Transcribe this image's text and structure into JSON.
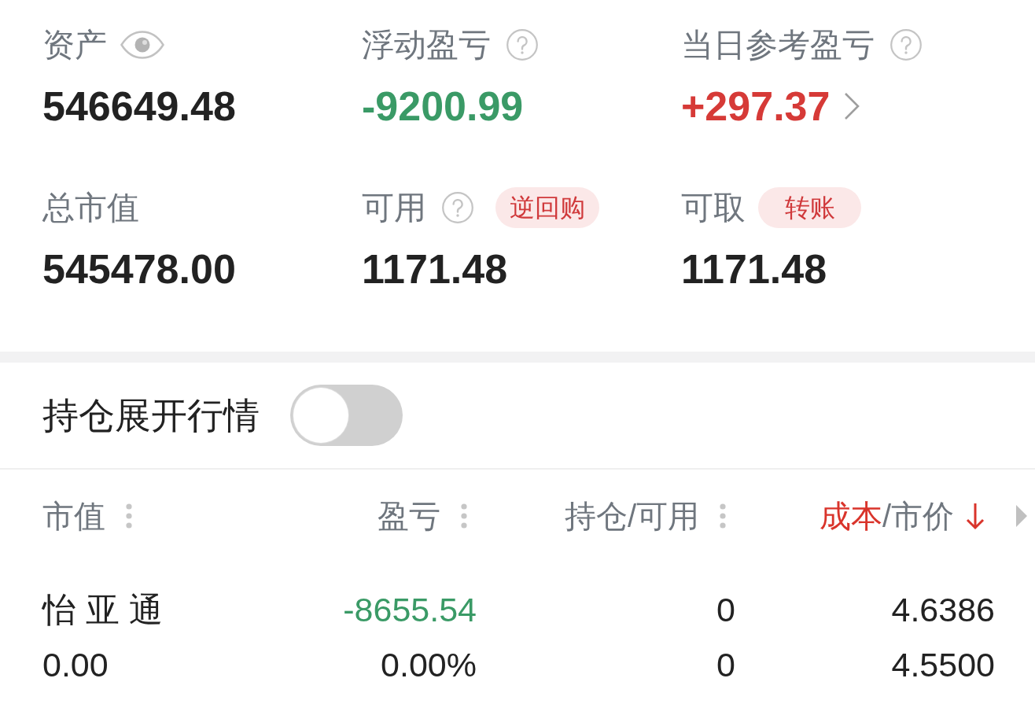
{
  "summary": [
    {
      "label": "资产",
      "kind": "eye",
      "value": "546649.48",
      "color": "#222222",
      "link": false
    },
    {
      "label": "浮动盈亏",
      "kind": "help",
      "value": "-9200.99",
      "color": "#3a9a66",
      "link": false
    },
    {
      "label": "当日参考盈亏",
      "kind": "help",
      "value": "+297.37",
      "color": "#d63a37",
      "link": true
    },
    {
      "label": "总市值",
      "kind": "plain",
      "value": "545478.00",
      "color": "#222222",
      "link": false
    },
    {
      "label": "可用",
      "kind": "help",
      "action": "逆回购",
      "value": "1171.48",
      "color": "#222222",
      "link": false
    },
    {
      "label": "可取",
      "kind": "plain",
      "action": "转账",
      "value": "1171.48",
      "color": "#222222",
      "link": false
    }
  ],
  "position_toggle": {
    "label": "持仓展开行情",
    "on": false
  },
  "holdings": {
    "columns": [
      {
        "parts": [
          {
            "text": "市值",
            "selected": false
          }
        ],
        "sorted": false
      },
      {
        "parts": [
          {
            "text": "盈亏",
            "selected": false
          }
        ],
        "sorted": false
      },
      {
        "parts": [
          {
            "text": "持仓/可用",
            "selected": false
          }
        ],
        "sorted": false
      },
      {
        "parts": [
          {
            "text": "成本",
            "selected": true
          },
          {
            "text": "市价",
            "selected": false
          }
        ],
        "separator": "/",
        "sorted": true,
        "descending": true
      }
    ],
    "rows": [
      {
        "cells": [
          [
            {
              "text": "怡 亚 通",
              "color": "#222222"
            },
            {
              "text": "0.00",
              "color": "#222222"
            }
          ],
          [
            {
              "text": "-8655.54",
              "color": "#3a9a66"
            },
            {
              "text": "0.00%",
              "color": "#222222"
            }
          ],
          [
            {
              "text": "0",
              "color": "#222222"
            },
            {
              "text": "0",
              "color": "#222222"
            }
          ],
          [
            {
              "text": "4.6386",
              "color": "#222222"
            },
            {
              "text": "4.5500",
              "color": "#222222"
            }
          ]
        ]
      }
    ]
  }
}
